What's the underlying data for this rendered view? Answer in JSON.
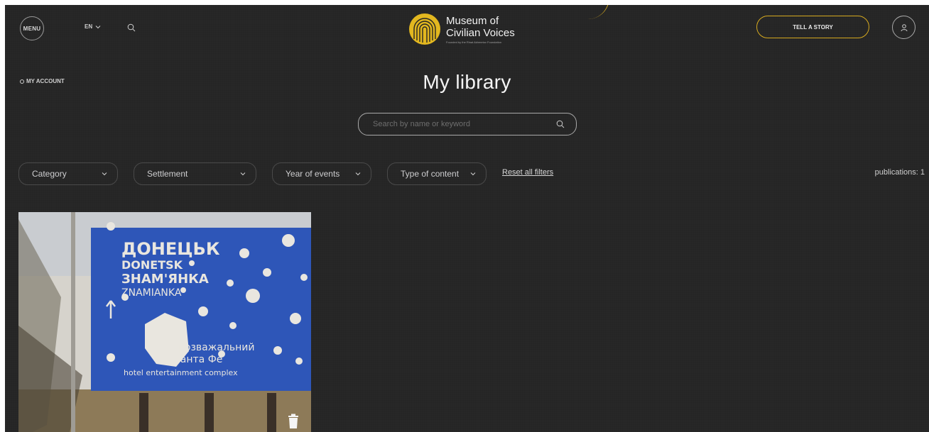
{
  "header": {
    "menu_label": "MENU",
    "language": "EN",
    "logo": {
      "title": "Museum of\nCivilian Voices",
      "subtitle": "Founded by the Rinat Akhmetov Foundation"
    },
    "tell_story_label": "TELL A STORY"
  },
  "breadcrumb": {
    "my_account_label": "MY ACCOUNT"
  },
  "page": {
    "title": "My library"
  },
  "search": {
    "placeholder": "Search by name or keyword",
    "value": ""
  },
  "filters": [
    {
      "label": "Category"
    },
    {
      "label": "Settlement"
    },
    {
      "label": "Year of events"
    },
    {
      "label": "Type of content"
    }
  ],
  "reset_label": "Reset all filters",
  "publications_count": "publications: 1",
  "library": {
    "items": [
      {
        "sign_text": [
          "ДОНЕЦЬК",
          "DONETSK",
          "ЗНАМ'ЯНКА",
          "ZNAMIANKA",
          "розважальний",
          "Санта Фе",
          "hotel entertainment complex"
        ]
      }
    ]
  },
  "colors": {
    "background": "#252525",
    "accent": "#d6a91f",
    "text": "#f4f4f4"
  },
  "icons": [
    "menu-circle",
    "chevron-down-icon",
    "search-icon",
    "museum-logo-fingerprint",
    "user-icon",
    "trash-icon"
  ]
}
